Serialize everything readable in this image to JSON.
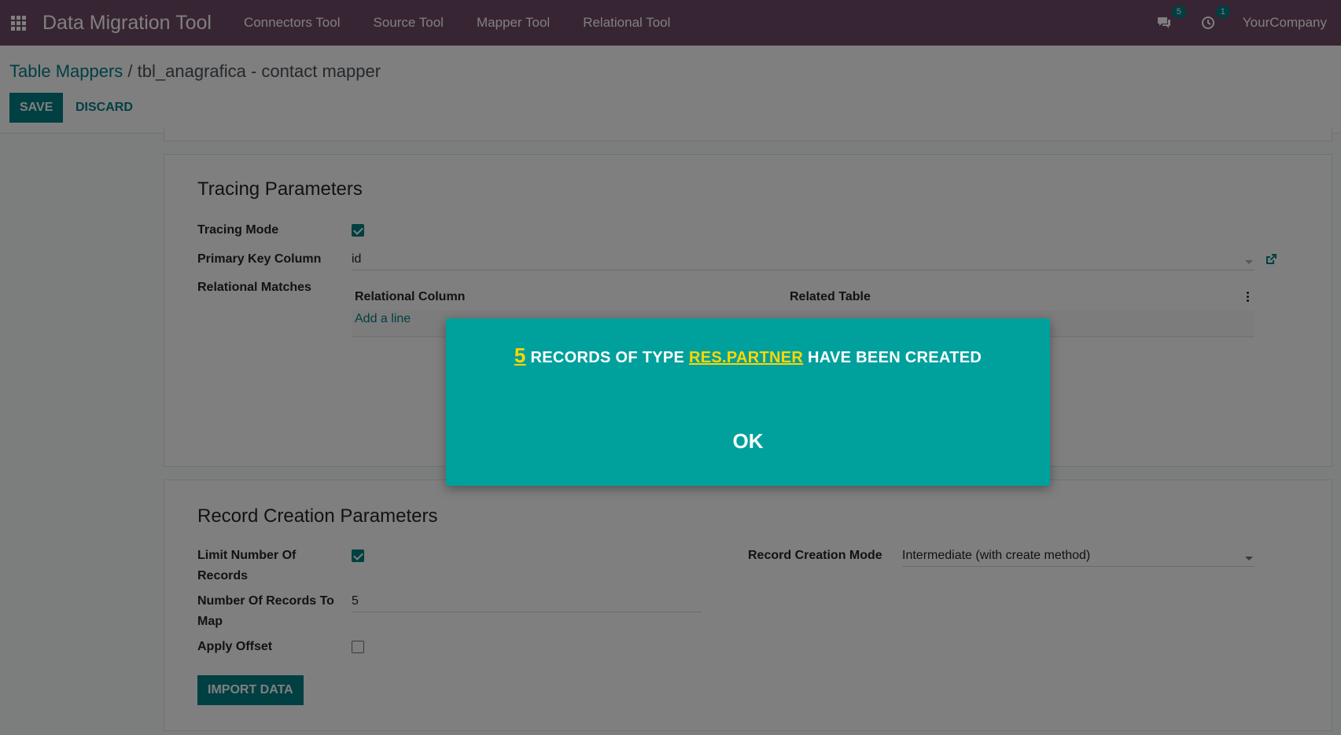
{
  "navbar": {
    "app_title": "Data Migration Tool",
    "menu": [
      "Connectors Tool",
      "Source Tool",
      "Mapper Tool",
      "Relational Tool"
    ],
    "chat_count": "5",
    "activity_count": "1",
    "company": "YourCompany"
  },
  "breadcrumb": {
    "parent": "Table Mappers",
    "separator": " / ",
    "current": "tbl_anagrafica - contact mapper"
  },
  "buttons": {
    "save": "SAVE",
    "discard": "DISCARD",
    "import": "IMPORT DATA"
  },
  "tracing": {
    "title": "Tracing Parameters",
    "tracing_mode_label": "Tracing Mode",
    "tracing_mode_checked": true,
    "primary_key_label": "Primary Key Column",
    "primary_key_value": "id",
    "relational_matches_label": "Relational Matches",
    "columns": [
      "Relational Column",
      "Related Table"
    ],
    "add_line": "Add a line"
  },
  "record_creation": {
    "title": "Record Creation Parameters",
    "limit_label": "Limit Number Of Records",
    "limit_checked": true,
    "number_label": "Number Of Records To Map",
    "number_value": "5",
    "offset_label": "Apply Offset",
    "offset_checked": false,
    "mode_label": "Record Creation Mode",
    "mode_value": "Intermediate (with create method)"
  },
  "modal": {
    "count": "5",
    "text_1": " RECORDS OF TYPE ",
    "model": "RES.PARTNER",
    "text_2": " HAVE BEEN CREATED",
    "ok": "OK"
  },
  "colors": {
    "navbar": "#714B67",
    "primary": "#017e84",
    "modal_bg": "#00a09d",
    "highlight": "#ffd700"
  }
}
